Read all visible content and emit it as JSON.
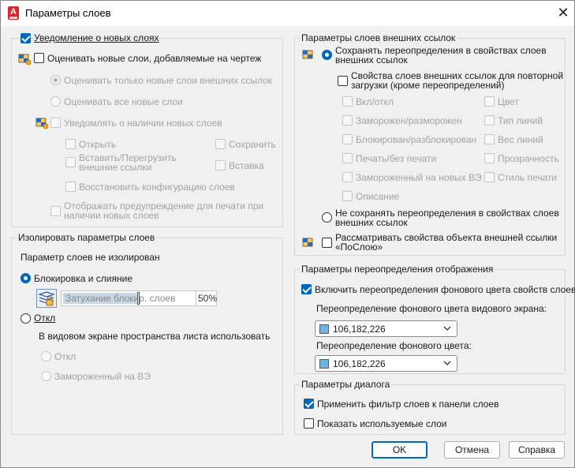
{
  "window": {
    "title": "Параметры слоев"
  },
  "colors": {
    "accent": "#0067c0",
    "swatch": "#6ab6e2",
    "app_icon": "#d9262b"
  },
  "new_layers": {
    "notify_label": "Уведомление о новых слоях",
    "evaluate_label": "Оценивать новые слои, добавляемые на чертеж",
    "only_xref_label": "Оценивать только новые слои внешних ссылок",
    "all_new_label": "Оценивать все новые слои",
    "notify_present_label": "Уведомлять о наличии новых слоев",
    "open_label": "Открыть",
    "save_label": "Сохранить",
    "attach_reload_label_1": "Вставить/Перегрузить",
    "attach_reload_label_2": "внешние ссылки",
    "insert_label": "Вставка",
    "restore_label": "Восстановить конфигурацию слоев",
    "plot_warning_label_1": "Отображать предупреждение для печати при",
    "plot_warning_label_2": "наличии новых слоев"
  },
  "isolate": {
    "title": "Изолировать параметры слоев",
    "status": "Параметр слоев не изолирован",
    "lock_fade_label": "Блокировка и слияние",
    "fade_label": "Затухание блокир. слоев",
    "fade_value": "50%",
    "off_label": "Откл",
    "viewport_label": "В видовом экране пространства листа использовать",
    "vp_off_label": "Откл",
    "vp_frozen_label": "Замороженный на ВЭ"
  },
  "xref": {
    "title": "Параметры слоев внешних ссылок",
    "keep_overrides_label_1": "Сохранять переопределения в свойствах слоев",
    "keep_overrides_label_2": "внешних ссылок",
    "reload_props_label_1": "Свойства слоев внешних ссылок для повторной",
    "reload_props_label_2": "загрузки (кроме переопределений)",
    "props": {
      "onoff": "Вкл/откл",
      "color": "Цвет",
      "freeze": "Заморожен/разморожен",
      "linetype": "Тип линий",
      "lock": "Блокирован/разблокирован",
      "lineweight": "Вес линий",
      "plot": "Печать/без печати",
      "transparency": "Прозрачность",
      "vpfreeze": "Замороженный на новых ВЭ",
      "plotstyle": "Стиль печати",
      "description": "Описание"
    },
    "no_keep_label_1": "Не сохранять переопределения в свойствах слоев",
    "no_keep_label_2": "внешних ссылок",
    "bylayer_label_1": "Рассматривать свойства объекта внешней ссылки",
    "bylayer_label_2": "«ПоСлою»"
  },
  "display_overrides": {
    "title": "Параметры переопределения отображения",
    "enable_label": "Включить переопределения фонового цвета свойств слоев",
    "viewport_bg_label": "Переопределение фонового цвета видового экрана:",
    "viewport_bg_value": "106,182,226",
    "bg_label": "Переопределение фонового цвета:",
    "bg_value": "106,182,226"
  },
  "dialog": {
    "title": "Параметры диалога",
    "apply_filter_label": "Применить фильтр слоев к панели слоев",
    "show_used_label": "Показать используемые слои"
  },
  "buttons": {
    "ok": "OK",
    "cancel": "Отмена",
    "help": "Справка"
  }
}
